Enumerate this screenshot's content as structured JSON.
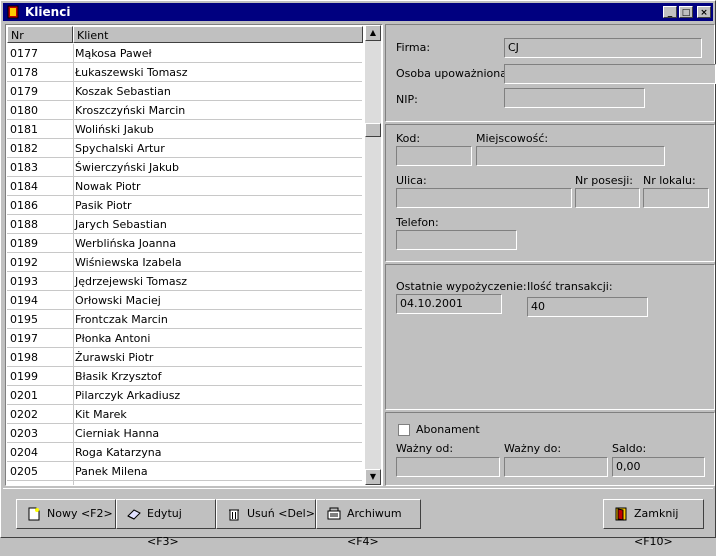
{
  "window": {
    "title": "Klienci",
    "controls": {
      "minimize": "_",
      "maximize": "□",
      "close": "×"
    }
  },
  "list": {
    "columns": [
      "Nr",
      "Klient"
    ],
    "rows": [
      {
        "nr": "0177",
        "klient": "Mąkosa Paweł"
      },
      {
        "nr": "0178",
        "klient": "Łukaszewski Tomasz"
      },
      {
        "nr": "0179",
        "klient": "Koszak Sebastian"
      },
      {
        "nr": "0180",
        "klient": "Kroszczyński Marcin"
      },
      {
        "nr": "0181",
        "klient": "Woliński Jakub"
      },
      {
        "nr": "0182",
        "klient": "Spychalski Artur"
      },
      {
        "nr": "0183",
        "klient": "Świerczyński Jakub"
      },
      {
        "nr": "0184",
        "klient": "Nowak Piotr"
      },
      {
        "nr": "0186",
        "klient": "Pasik Piotr"
      },
      {
        "nr": "0188",
        "klient": "Jarych Sebastian"
      },
      {
        "nr": "0189",
        "klient": "Werblińska Joanna"
      },
      {
        "nr": "0192",
        "klient": "Wiśniewska Izabela"
      },
      {
        "nr": "0193",
        "klient": "Jędrzejewski Tomasz"
      },
      {
        "nr": "0194",
        "klient": "Orłowski Maciej"
      },
      {
        "nr": "0195",
        "klient": "Frontczak Marcin"
      },
      {
        "nr": "0197",
        "klient": "Płonka Antoni"
      },
      {
        "nr": "0198",
        "klient": "Żurawski Piotr"
      },
      {
        "nr": "0199",
        "klient": "Błasik Krzysztof"
      },
      {
        "nr": "0201",
        "klient": "Pilarczyk Arkadiusz"
      },
      {
        "nr": "0202",
        "klient": "Kit Marek"
      },
      {
        "nr": "0203",
        "klient": "Cierniak Hanna"
      },
      {
        "nr": "0204",
        "klient": "Roga Katarzyna"
      },
      {
        "nr": "0205",
        "klient": "Panek Milena"
      }
    ]
  },
  "details": {
    "firma_label": "Firma:",
    "firma_value": "CJ",
    "osoba_label": "Osoba upoważniona:",
    "osoba_value": "",
    "nip_label": "NIP:",
    "nip_value": "",
    "kod_label": "Kod:",
    "kod_value": "",
    "miejscowosc_label": "Miejscowość:",
    "miejscowosc_value": "",
    "ulica_label": "Ulica:",
    "ulica_value": "",
    "nr_posesji_label": "Nr posesji:",
    "nr_posesji_value": "",
    "nr_lokalu_label": "Nr lokalu:",
    "nr_lokalu_value": "",
    "telefon_label": "Telefon:",
    "telefon_value": "",
    "ostatnie_label": "Ostatnie wypożyczenie:",
    "ostatnie_value": "04.10.2001",
    "ilosc_label": "Ilość transakcji:",
    "ilosc_value": "40",
    "abonament_label": "Abonament",
    "abonament_checked": false,
    "wazny_od_label": "Ważny od:",
    "wazny_od_value": "",
    "wazny_do_label": "Ważny do:",
    "wazny_do_value": "",
    "saldo_label": "Saldo:",
    "saldo_value": "0,00"
  },
  "buttons": {
    "nowy": "Nowy <F2>",
    "edytuj": "Edytuj <F3>",
    "usun": "Usuń <Del>",
    "archiwum": "Archiwum <F4>",
    "zamknij": "Zamknij <F10>"
  }
}
